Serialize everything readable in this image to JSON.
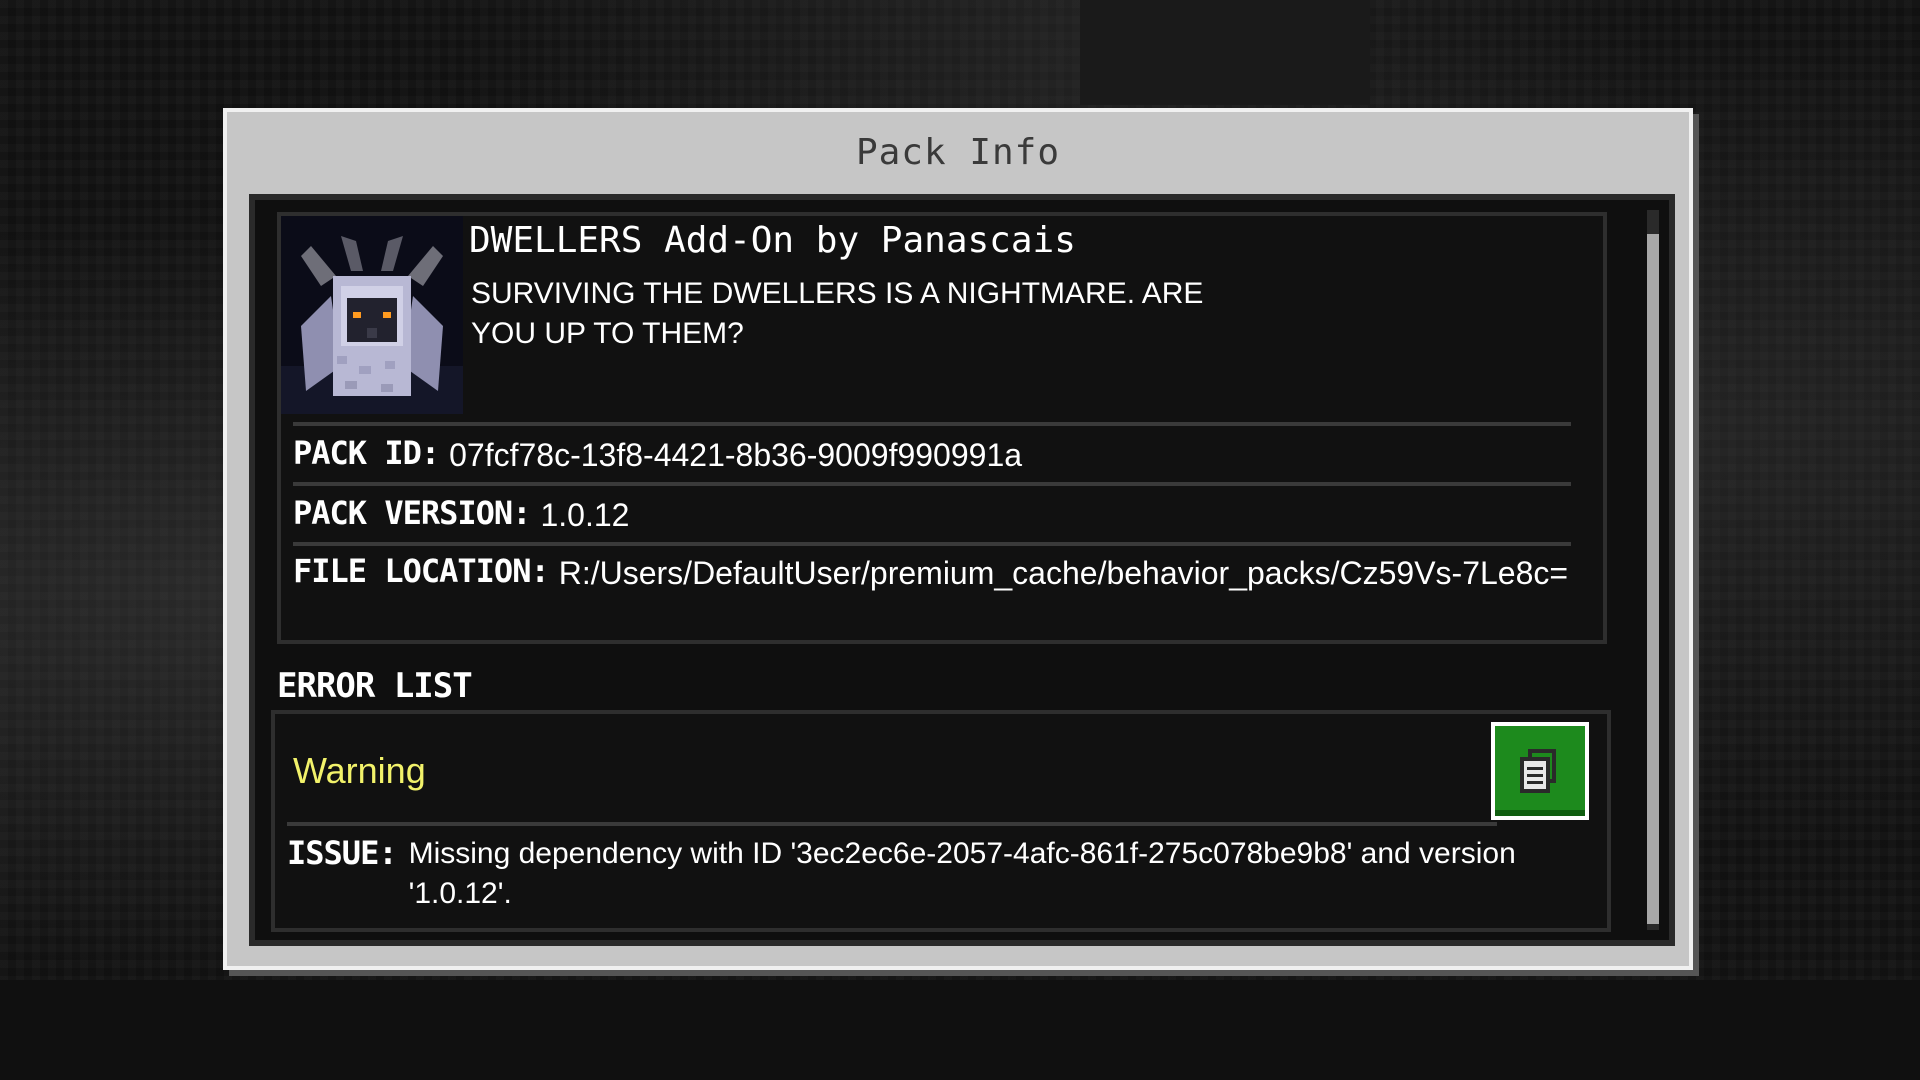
{
  "dialog": {
    "title": "Pack Info"
  },
  "pack": {
    "icon": "dweller-creature-icon",
    "name": "DWELLERS Add-On by Panascais",
    "description": "SURVIVING THE DWELLERS IS A NIGHTMARE. ARE YOU UP TO THEM?",
    "id_label": "PACK ID:",
    "id_value": "07fcf78c-13f8-4421-8b36-9009f990991a",
    "version_label": "PACK VERSION:",
    "version_value": "1.0.12",
    "location_label": "FILE LOCATION:",
    "location_value": "R:/Users/DefaultUser/premium_cache/behavior_packs/Cz59Vs-7Le8c="
  },
  "error_list": {
    "title": "ERROR LIST",
    "items": [
      {
        "severity": "Warning",
        "severity_color": "#f2f26a",
        "issue_label": "ISSUE:",
        "issue_text": "Missing dependency with ID '3ec2ec6e-2057-4afc-861f-275c078be9b8' and version '1.0.12'.",
        "copy_icon": "copy-clipboard-icon"
      }
    ]
  },
  "colors": {
    "dialog_frame": "#c6c6c6",
    "panel_bg": "#0f0f0f",
    "copy_button": "#1d8a1d"
  }
}
